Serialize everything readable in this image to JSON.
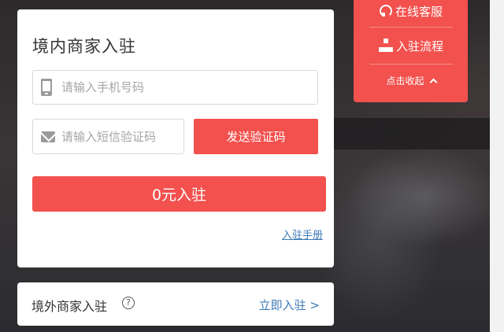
{
  "register_card": {
    "title": "境内商家入驻",
    "phone": {
      "placeholder": "请输入手机号码",
      "value": ""
    },
    "sms_code": {
      "placeholder": "请输入短信验证码",
      "value": ""
    },
    "send_code_label": "发送验证码",
    "join_label": "0元入驻",
    "manual_link": "入驻手册"
  },
  "overseas_card": {
    "title": "境外商家入驻",
    "help_glyph": "?",
    "link_label": "立即入驻 >"
  },
  "side_panel": {
    "service_label": "在线客服",
    "process_label": "入驻流程",
    "collapse_label": "点击收起"
  },
  "colors": {
    "accent": "#f2514e",
    "link": "#3c7ab5"
  },
  "icons": [
    "phone-icon",
    "mail-icon",
    "help-icon",
    "headset-icon",
    "flowchart-icon",
    "chevron-up-icon"
  ]
}
